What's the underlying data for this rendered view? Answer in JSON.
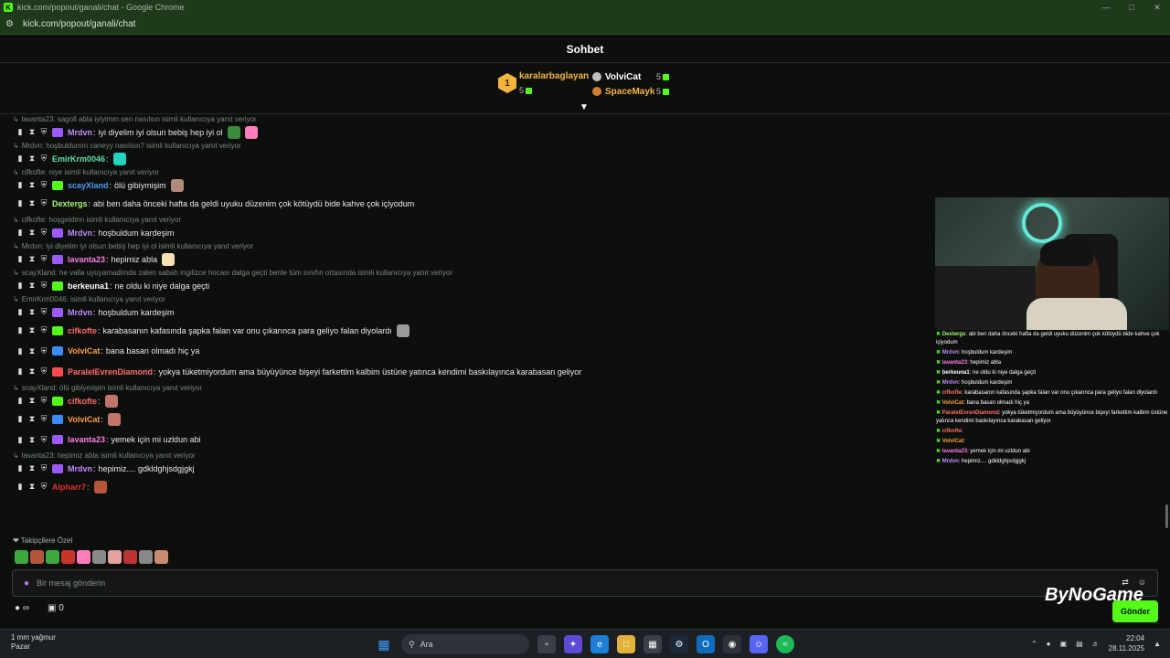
{
  "browser": {
    "title": "kick.com/popout/ganali/chat - Google Chrome",
    "url": "kick.com/popout/ganali/chat",
    "favicon_letter": "K"
  },
  "chat": {
    "header_title": "Sohbet",
    "leaderboard": [
      {
        "rank": "1",
        "name": "karalarbaglayan",
        "count": "5",
        "color": "#f2b43c"
      },
      {
        "rank": "2",
        "name": "VolviCat",
        "count": "5",
        "color": "#ffffff"
      },
      {
        "rank": "3",
        "name": "SpaceMayk",
        "count": "5",
        "color": "#f2b43c"
      }
    ],
    "messages": [
      {
        "reply": "lavanta23: sagoll abla iyiyimm sen nasılsın isimli kullanıcıya yanıt veriyor",
        "user": "Mrdvn",
        "color": "#c08bff",
        "badge": "#9b59ff",
        "text": "iyi diyelim iyi olsun bebiş hep iyi ol",
        "emotes": [
          "#3c8b3c",
          "#ff7dbd"
        ]
      },
      {
        "reply": "Mrdvn: hoşbuldumm caneyy nasılsın? isimli kullanıcıya yanıt veriyor",
        "user": "EmirKrm0046",
        "color": "#5fe0a0",
        "badge": "",
        "text": "",
        "emotes": [
          "#23d4c0"
        ]
      },
      {
        "reply": "cifkofte: niye isimli kullanıcıya yanıt veriyor",
        "user": "scayXland",
        "color": "#4f9bff",
        "badge": "#53fc18",
        "text": "ölü gibiymişim",
        "emotes": [
          "#b08a7a"
        ]
      },
      {
        "reply": "",
        "user": "Dextergs",
        "color": "#a5f56e",
        "badge": "",
        "text": "abi ben daha önceki hafta da geldi uyuku düzenim çok kötüydü bide kahve çok içiyodum",
        "emotes": []
      },
      {
        "reply": "cifkofte: hoşgeldinn isimli kullanıcıya yanıt veriyor",
        "user": "Mrdvn",
        "color": "#c08bff",
        "badge": "#9b59ff",
        "text": "hoşbuldum kardeşim",
        "emotes": []
      },
      {
        "reply": "Mrdvn: iyi diyelim iyi olsun bebiş hep iyi ol isimli kullanıcıya yanıt veriyor",
        "user": "lavanta23",
        "color": "#ff7de9",
        "badge": "#9b59ff",
        "text": "hepimiz abla",
        "emotes": [
          "#f5e2b0"
        ]
      },
      {
        "reply": "scayXland: he valla uyuyamadimda zaten sabah ingilizce hocası dalga geçti benle tüm sınıfın ortasında isimli kullanıcıya yanıt veriyor",
        "user": "berkeuna1",
        "color": "#ffffff",
        "badge": "#53fc18",
        "text": "ne oldu ki niye dalga geçti",
        "emotes": []
      },
      {
        "reply": "EmirKrm0046: isimli kullanıcıya yanıt veriyor",
        "user": "Mrdvn",
        "color": "#c08bff",
        "badge": "#9b59ff",
        "text": "hoşbuldum kardeşim",
        "emotes": []
      },
      {
        "reply": "",
        "user": "cifkofte",
        "color": "#ff6b6b",
        "badge": "#53fc18",
        "text": "karabasanın kafasında şapka falan var onu çıkarınca para geliyo falan diyolardı",
        "emotes": [
          "#9a9a9a"
        ]
      },
      {
        "reply": "",
        "user": "VolviCat",
        "color": "#ff9f3a",
        "badge": "#3a8bff",
        "text": "bana basan olmadı hiç ya",
        "emotes": []
      },
      {
        "reply": "",
        "user": "ParalelEvrenDiamond",
        "color": "#ff6b6b",
        "badge": "#ff4b4b",
        "text": "yokya tüketmiyordum ama büyüyünce bişeyi farkettim kalbim üstüne yatınca kendimi baskılayınca karabasan geliyor",
        "emotes": []
      },
      {
        "reply": "scayXland: ölü gibiymişim isimli kullanıcıya yanıt veriyor",
        "user": "cifkofte",
        "color": "#ff6b6b",
        "badge": "#53fc18",
        "text": "",
        "emotes": [
          "#c4756b"
        ]
      },
      {
        "reply": "",
        "user": "VolviCat",
        "color": "#ff9f3a",
        "badge": "#3a8bff",
        "text": "",
        "emotes": [
          "#c4756b"
        ]
      },
      {
        "reply": "",
        "user": "lavanta23",
        "color": "#ff7de9",
        "badge": "#9b59ff",
        "text": "yemek için mi uzldun abi",
        "emotes": []
      },
      {
        "reply": "lavanta23: hepimiz abla isimli kullanıcıya yanıt veriyor",
        "user": "Mrdvn",
        "color": "#c08bff",
        "badge": "#9b59ff",
        "text": "hepimiz.... gdkldghjsdgjgkj",
        "emotes": []
      },
      {
        "reply": "",
        "user": "Alpharr7",
        "color": "#e03030",
        "badge": "",
        "text": "",
        "emotes": [
          "#b5563a"
        ]
      }
    ],
    "followers_only": "Takipçilere Özel",
    "emote_bar": [
      "#3ea83e",
      "#b5563a",
      "#3ea83e",
      "#c9342a",
      "#ff7dbd",
      "#8a8a8a",
      "#e5a0a0",
      "#b33",
      "#888",
      "#c98a70"
    ],
    "input_placeholder": "Bir mesaj gönderin",
    "send_label": "Gönder",
    "bottom_infinity": "∞",
    "bottom_count": "0"
  },
  "overlay": {
    "brand": "ByNoGame",
    "lines": [
      {
        "user": "Dextergs",
        "text": ": abi ben daha önceki hafta da geldi uyuku düzenim çok kötüydü bide kahve çok içiyodum",
        "color": "#a5f56e"
      },
      {
        "user": "Mrdvn",
        "text": ": hoşbuldum kardeşim",
        "color": "#c08bff"
      },
      {
        "user": "lavanta23",
        "text": ": hepimiz abla",
        "color": "#ff7de9"
      },
      {
        "user": "berkeuna1",
        "text": ": ne oldu ki niye dalga geçti",
        "color": "#ffffff"
      },
      {
        "user": "Mrdvn",
        "text": ": hoşbuldum kardeşim",
        "color": "#c08bff"
      },
      {
        "user": "cifkofte",
        "text": ": karabasanın kafasında şapka falan var onu çıkarınca para geliyo falan diyolardı",
        "color": "#ff6b6b"
      },
      {
        "user": "VolviCat",
        "text": ": bana basan olmadı hiç ya",
        "color": "#ff9f3a"
      },
      {
        "user": "ParalelEvrenDiamond",
        "text": ": yokya tüketmiyordum ama büyüyünce bişeyi farkettim kalbim üstüne yatınca kendimi baskılayınca karabasan geliyor",
        "color": "#ff6b6b"
      },
      {
        "user": "cifkofte",
        "text": ":",
        "color": "#ff6b6b"
      },
      {
        "user": "VolviCat",
        "text": ":",
        "color": "#ff9f3a"
      },
      {
        "user": "lavanta23",
        "text": ": yemek için mi uzldun abi",
        "color": "#ff7de9"
      },
      {
        "user": "Mrdvn",
        "text": ": hepimiz.... gdkldghjsdgjgkj",
        "color": "#c08bff"
      }
    ]
  },
  "taskbar": {
    "weather_temp": "1 mm yağmur",
    "weather_day": "Pazar",
    "search_label": "Ara",
    "time": "22:04",
    "date": "28.11.2025"
  }
}
